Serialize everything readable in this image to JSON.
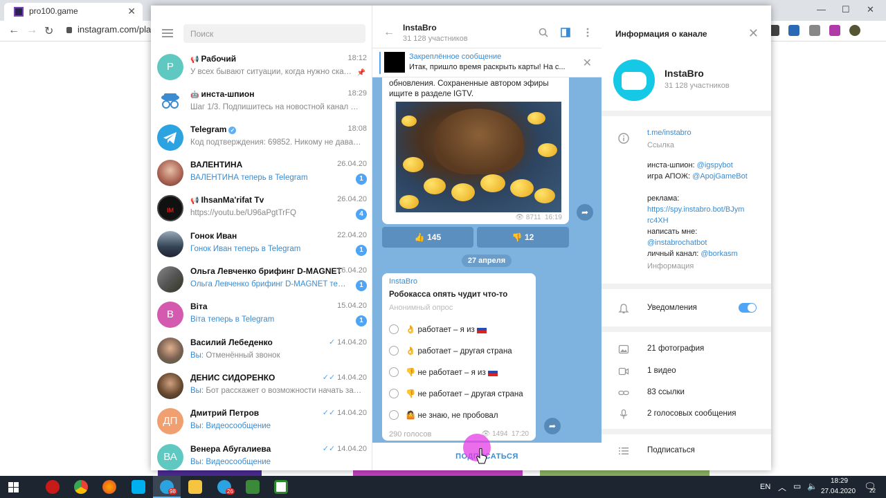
{
  "browser": {
    "tab_title": "pro100.game",
    "url": "instagram.com/plas"
  },
  "search": {
    "placeholder": "Поиск"
  },
  "chats": [
    {
      "name": "Рабочий",
      "time": "18:12",
      "preview": "У всех бывают ситуации, когда нужно скач...",
      "avatar_letter": "Р",
      "avatar_color": "#5fc8c0"
    },
    {
      "name": "инста-шпион",
      "time": "18:29",
      "preview": "Шаг 1/3. Подпишитесь на новостной канал @in...",
      "avatar_color": "#3a8bd1"
    },
    {
      "name": "Telegram",
      "time": "18:08",
      "preview": "Код подтверждения: 69852. Никому не давайте ...",
      "avatar_color": "#2aa3e0"
    },
    {
      "name": "ВАЛЕНТИНА",
      "time": "26.04.20",
      "preview": "ВАЛЕНТИНА теперь в Telegram",
      "badge": "1",
      "avatar_color": "#c99a8a"
    },
    {
      "name": "IhsanMa'rifat Tv",
      "time": "26.04.20",
      "preview": "https://youtu.be/U96aPgtTrFQ",
      "badge": "4",
      "avatar_color": "#111111"
    },
    {
      "name": "Гонок Иван",
      "time": "22.04.20",
      "preview": "Гонок Иван теперь в Telegram",
      "badge": "1",
      "avatar_color": "#4a5a70"
    },
    {
      "name": "Ольга Левченко брифинг D-MAGNET",
      "time": "16.04.20",
      "preview": "Ольга Левченко брифинг D-MAGNET тепер...",
      "badge": "1",
      "avatar_color": "#6a6a6a"
    },
    {
      "name": "Віта",
      "time": "15.04.20",
      "preview": "Віта теперь в Telegram",
      "badge": "1",
      "avatar_letter": "В",
      "avatar_color": "#d45ab0"
    },
    {
      "name": "Василий Лебеденко",
      "time": "14.04.20",
      "preview_prefix": "Вы: ",
      "preview": "Отменённый звонок",
      "avatar_color": "#7a8a6a"
    },
    {
      "name": "ДЕНИС СИДОРЕНКО",
      "time": "14.04.20",
      "preview_prefix": "Вы: ",
      "preview": "Бот расскажет о возможности начать зара...",
      "avatar_color": "#5a4a3a"
    },
    {
      "name": "Дмитрий Петров",
      "time": "14.04.20",
      "preview_prefix": "Вы: ",
      "preview": "Видеосообщение",
      "avatar_letter": "ДП",
      "avatar_color": "#f0a070"
    },
    {
      "name": "Венера Абугалиева",
      "time": "14.04.20",
      "preview_prefix": "Вы: ",
      "preview": "Видеосообщение",
      "avatar_letter": "ВА",
      "avatar_color": "#5fc8c0"
    }
  ],
  "channel": {
    "title": "InstaBro",
    "subscribers": "31 128 участников"
  },
  "pinned": {
    "title": "Закреплённое сообщение",
    "text": "Итак, пришло время раскрыть карты! На с..."
  },
  "message1": {
    "text": "обновления. Сохраненные автором эфиры ищите в разделе IGTV.",
    "views": "8711",
    "time": "16:19"
  },
  "reactions": {
    "like": "👍 145",
    "dislike": "👎 12"
  },
  "date_separator": "27 апреля",
  "poll": {
    "author": "InstaBro",
    "question": "Робокасса опять чудит что-то",
    "type": "Анонимный опрос",
    "options": [
      "работает – я из",
      "работает – другая страна",
      "не работает – я из",
      "не работает – другая страна",
      "не знаю, не пробовал"
    ],
    "votes": "290 голосов",
    "views": "1494",
    "time": "17:20"
  },
  "subscribe_label": "ПОДПИСАТЬСЯ",
  "info": {
    "title": "Информация о канале",
    "name": "InstaBro",
    "subscribers": "31 128 участников",
    "link": "t.me/instabro",
    "link_caption": "Ссылка",
    "desc_line1_label": "инста-шпион: ",
    "desc_line1_link": "@igspybot",
    "desc_line2_label": "игра АПОЖ: ",
    "desc_line2_link": "@ApojGameBot",
    "ads_label": "реклама:",
    "ads_link1": "https://spy.instabro.bot/BJym",
    "ads_link2": "rc4XH",
    "write_label": "написать мне:",
    "write_link": "@instabrochatbot",
    "personal_label": "личный канал: ",
    "personal_link": "@borkasm",
    "info_caption": "Информация",
    "notifications": "Уведомления",
    "media": [
      "21 фотография",
      "1 видео",
      "83 ссылки",
      "2 голосовых сообщения"
    ],
    "subscribe": "Подписаться"
  },
  "taskbar": {
    "lang": "EN",
    "time": "18:29",
    "date": "27.04.2020",
    "notif_count": "22",
    "tg_badge_1": "98",
    "tg_badge_2": "26"
  },
  "colors": {
    "accent": "#4ea4f6",
    "chat_bg": "#7fb3df",
    "link": "#3a8bd1"
  }
}
